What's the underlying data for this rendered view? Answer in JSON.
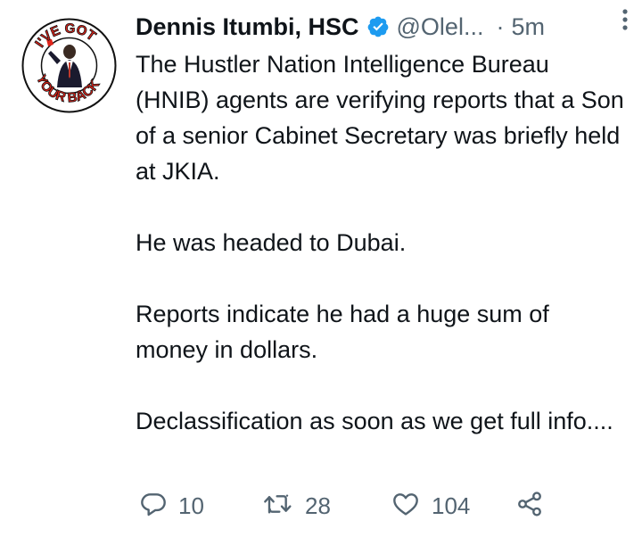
{
  "tweet": {
    "author_name": "Dennis Itumbi, HSC",
    "handle": "@Olel...",
    "separator": "·",
    "time": "5m",
    "avatar_badge_text": "I'VE GOT YOUR BACK",
    "paragraphs": [
      "The Hustler Nation Intelligence Bureau (HNIB) agents are verifying reports that a Son of a senior Cabinet Secretary was briefly held at JKIA.",
      "He was headed to Dubai.",
      "Reports indicate he had a huge sum of money in dollars.",
      "Declassification as soon as we get full info...."
    ]
  },
  "actions": {
    "replies": "10",
    "retweets": "28",
    "likes": "104"
  },
  "colors": {
    "text": "#0f1419",
    "secondary": "#536471",
    "verified": "#1d9bf0",
    "badge_red": "#e0241b"
  },
  "icons": [
    "reply-icon",
    "retweet-icon",
    "like-icon",
    "share-icon",
    "verified-icon",
    "more-icon"
  ]
}
